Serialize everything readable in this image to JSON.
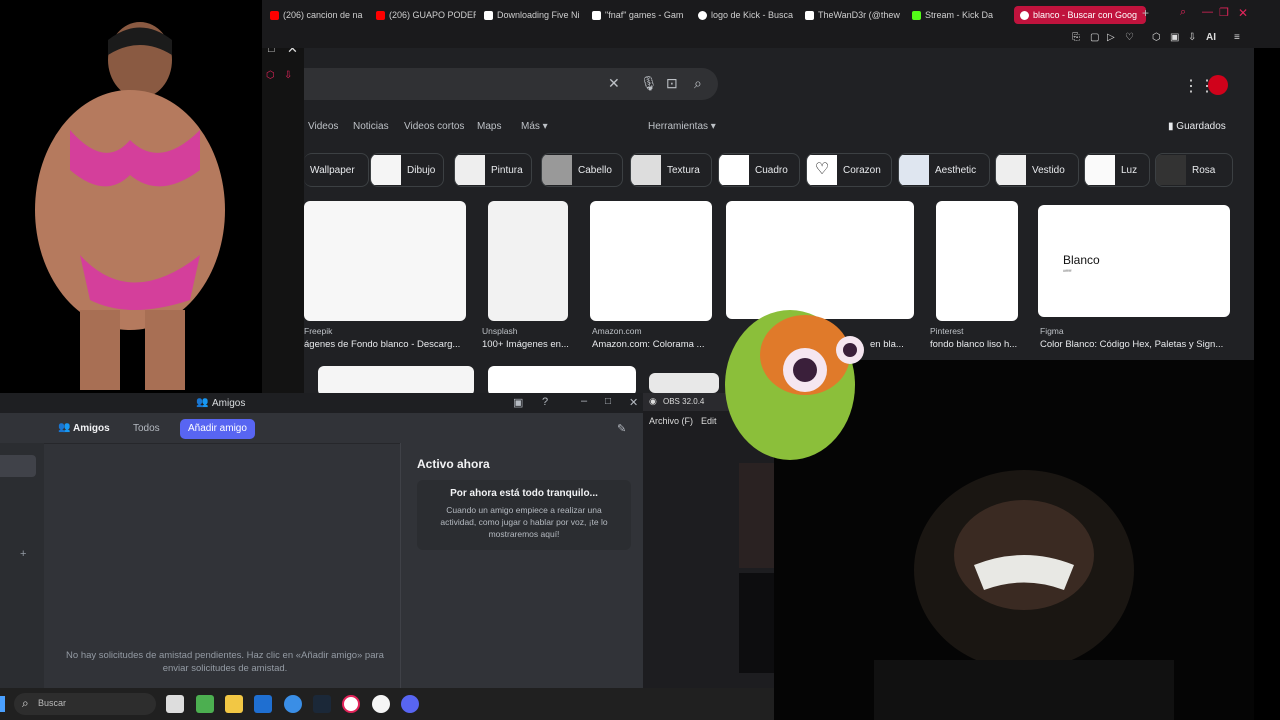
{
  "browser": {
    "tabs": [
      {
        "label": "(206) cancion de na",
        "favicon_color": "#ff0000"
      },
      {
        "label": "(206) GUAPO PODER",
        "favicon_color": "#ff0000"
      },
      {
        "label": "Downloading Five Ni",
        "favicon_color": "#ffffff"
      },
      {
        "label": "\"fnaf\" games - Gam",
        "favicon_color": "#ffffff"
      },
      {
        "label": "logo de Kick - Busca",
        "favicon_color": "#ffffff"
      },
      {
        "label": "TheWanD3r (@thew",
        "favicon_color": "#ffffff"
      },
      {
        "label": "Stream - Kick Da",
        "favicon_color": "#53fc18"
      },
      {
        "label": "blanco - Buscar con Goog",
        "favicon_color": "#ffffff"
      }
    ],
    "ai_label": "AI"
  },
  "google": {
    "nav": [
      "Videos",
      "Noticias",
      "Videos cortos",
      "Maps",
      "Más",
      "Herramientas"
    ],
    "saved_label": "Guardados",
    "chips": [
      "Wallpaper",
      "Dibujo",
      "Pintura",
      "Cabello",
      "Textura",
      "Cuadro",
      "Corazon",
      "Aesthetic",
      "Vestido",
      "Luz",
      "Rosa"
    ],
    "results": [
      {
        "source": "Freepik",
        "caption": "ágenes de Fondo blanco - Descarg..."
      },
      {
        "source": "Unsplash",
        "caption": "100+ Imágenes en..."
      },
      {
        "source": "Amazon.com",
        "caption": "Amazon.com: Colorama ..."
      },
      {
        "source": "",
        "caption": "en bla..."
      },
      {
        "source": "Pinterest",
        "caption": "fondo blanco liso h..."
      },
      {
        "source": "Figma",
        "caption": "Color Blanco: Código Hex, Paletas y Sign..."
      }
    ],
    "blanco_card_text": "Blanco",
    "blanco_card_sub": "#ffffff"
  },
  "discord": {
    "window_title": "Amigos",
    "tabs": {
      "friends": "Amigos",
      "all": "Todos",
      "add": "Añadir amigo"
    },
    "pending_text": "No hay solicitudes de amistad pendientes. Haz clic en «Añadir amigo» para enviar solicitudes de amistad.",
    "active_title": "Activo ahora",
    "active_heading": "Por ahora está todo tranquilo...",
    "active_body": "Cuando un amigo empiece a realizar una actividad, como jugar o hablar por voz, ¡te lo mostraremos aquí!"
  },
  "obs": {
    "title": "OBS 32.0.4",
    "menu": [
      "Archivo (F)",
      "Edit"
    ]
  },
  "taskbar": {
    "search_placeholder": "Buscar"
  }
}
